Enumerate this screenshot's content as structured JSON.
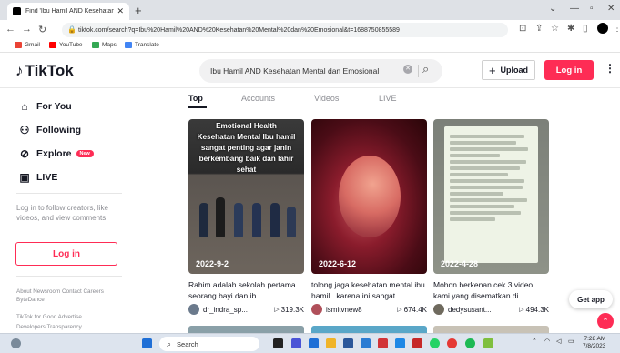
{
  "browser": {
    "tab_title": "Find 'Ibu Hamil AND Kesehatan M",
    "url": "tiktok.com/search?q=Ibu%20Hamil%20AND%20Kesehatan%20Mental%20dan%20Emosional&t=1688750855589",
    "bookmarks": [
      {
        "label": "Gmail",
        "color": "#ea4335"
      },
      {
        "label": "YouTube",
        "color": "#ff0000"
      },
      {
        "label": "Maps",
        "color": "#34a853"
      },
      {
        "label": "Translate",
        "color": "#4285f4"
      }
    ]
  },
  "header": {
    "logo": "TikTok",
    "search_query": "Ibu Hamil AND Kesehatan Mental dan Emosional",
    "upload_label": "Upload",
    "login_label": "Log in"
  },
  "sidebar": {
    "items": [
      {
        "label": "For You",
        "icon": "home-icon"
      },
      {
        "label": "Following",
        "icon": "people-icon"
      },
      {
        "label": "Explore",
        "icon": "compass-icon",
        "badge": "New"
      },
      {
        "label": "LIVE",
        "icon": "live-icon"
      }
    ],
    "prompt": "Log in to follow creators, like videos, and view comments.",
    "login_label": "Log in",
    "footer_line1": "About  Newsroom  Contact  Careers",
    "footer_line2": "ByteDance",
    "footer_line3": "TikTok for Good  Advertise",
    "footer_line4": "Developers  Transparency"
  },
  "tabs": [
    "Top",
    "Accounts",
    "Videos",
    "LIVE"
  ],
  "videos": [
    {
      "date": "2022-9-2",
      "caption_overlay": "Emotional Health\nKesehatan Mental Ibu hamil sangat penting agar janin berkembang baik dan lahir sehat",
      "description": "Rahim adalah sekolah pertama seorang bayi dan ib...",
      "user": "dr_indra_sp...",
      "views": "319.3K"
    },
    {
      "date": "2022-6-12",
      "description": "tolong jaga kesehatan mental ibu hamil.. karena ini sangat...",
      "user": "ismitvnew8",
      "views": "674.4K"
    },
    {
      "date": "2022-4-28",
      "description": "Mohon berkenan cek 3 video kami yang disematkan di...",
      "user": "dedysusant...",
      "views": "494.3K"
    }
  ],
  "get_app_label": "Get app",
  "taskbar": {
    "search_placeholder": "Search",
    "time": "7:28 AM",
    "date": "7/8/2023"
  }
}
